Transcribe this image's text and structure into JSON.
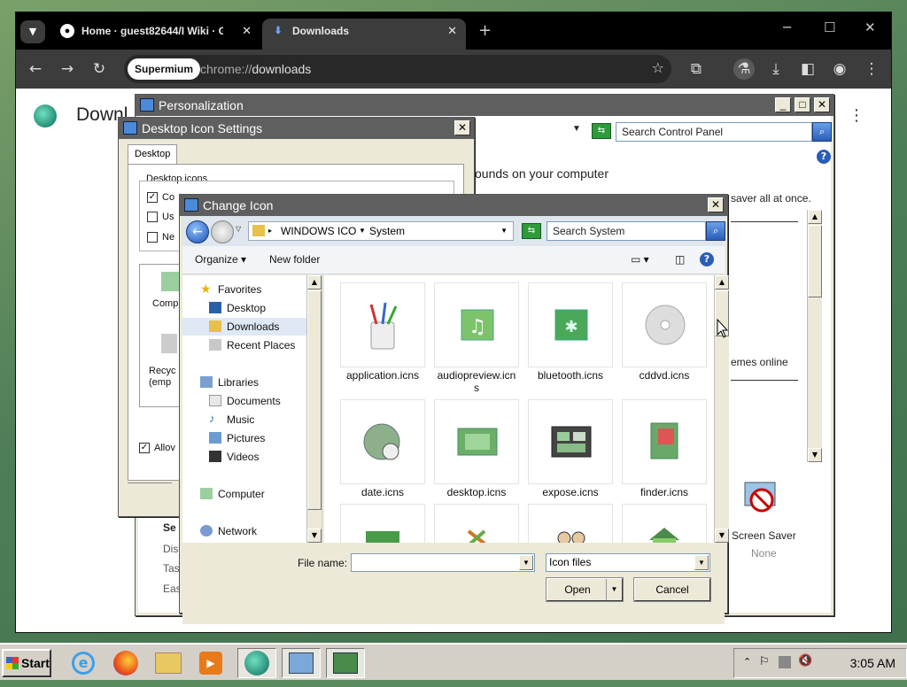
{
  "browser": {
    "tab1_title": "Home · guest82644/I Wiki · Gi",
    "tab1_close": "✕",
    "tab2_title": "Downloads",
    "tab2_close": "✕",
    "new_tab": "+",
    "chip": "Supermium",
    "url_scheme": "chrome://",
    "url_path": "downloads",
    "page_title": "Downl"
  },
  "personalization": {
    "title": "Personalization",
    "search_placeholder": "Search Control Panel",
    "heading_fragment": "ounds on your computer",
    "side_text": "saver all at once.",
    "themes_link": "emes online",
    "screen_saver_label": "Screen Saver",
    "screen_saver_value": "None",
    "left_frag": [
      "Se",
      "Dis",
      "Tas",
      "Eas"
    ]
  },
  "desktop_icon_settings": {
    "title": "Desktop Icon Settings",
    "tab": "Desktop Icons",
    "group_label": "Desktop icons",
    "checkbox_labels": [
      "Co",
      "Us",
      "Ne"
    ],
    "checkbox_checked": [
      true,
      false,
      false
    ],
    "icon_labels": [
      "Comp",
      "Recyc\n(emp"
    ],
    "allow_label": "Allov"
  },
  "change_icon": {
    "title": "Change Icon",
    "crumb_parts": [
      "WINDOWS ICO",
      "System"
    ],
    "search_placeholder": "Search System",
    "organize": "Organize",
    "new_folder": "New folder",
    "nav_items": [
      {
        "label": "Favorites",
        "icon": "star-icon"
      },
      {
        "label": "Desktop",
        "icon": "desktop-icon"
      },
      {
        "label": "Downloads",
        "icon": "downloads-folder-icon"
      },
      {
        "label": "Recent Places",
        "icon": "recent-places-icon"
      },
      {
        "label": "Libraries",
        "icon": "libraries-icon"
      },
      {
        "label": "Documents",
        "icon": "documents-icon"
      },
      {
        "label": "Music",
        "icon": "music-icon"
      },
      {
        "label": "Pictures",
        "icon": "pictures-icon"
      },
      {
        "label": "Videos",
        "icon": "videos-icon"
      },
      {
        "label": "Computer",
        "icon": "computer-icon"
      },
      {
        "label": "Network",
        "icon": "network-icon"
      }
    ],
    "files": [
      "application.icns",
      "audiopreview.icn\ns",
      "bluetooth.icns",
      "cddvd.icns",
      "date.icns",
      "desktop.icns",
      "expose.icns",
      "finder.icns"
    ],
    "file_name_label": "File name:",
    "file_name_value": "",
    "filter_value": "Icon files",
    "open_label": "Open",
    "cancel_label": "Cancel"
  },
  "taskbar": {
    "start_label": "Start",
    "clock": "3:05 AM"
  }
}
